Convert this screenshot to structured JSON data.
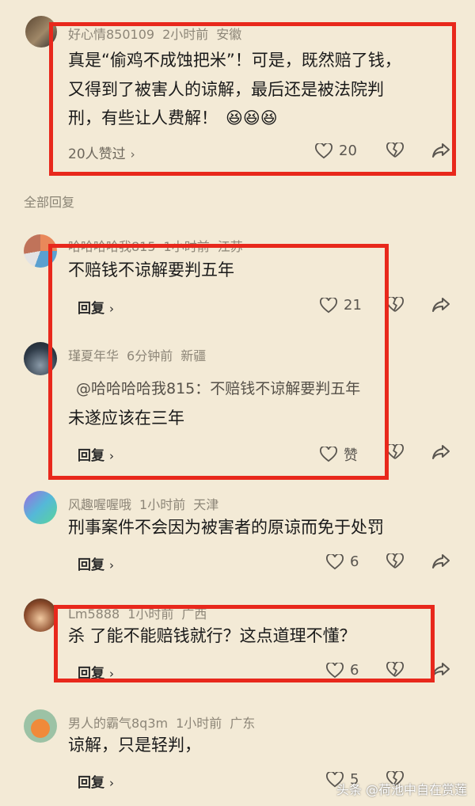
{
  "section_label": "全部回复",
  "watermark": "头条 @荷池中自在赏莲",
  "top_comment": {
    "user": "好心情850109",
    "time": "2小时前",
    "location": "安徽",
    "lines": [
      "真是“偷鸡不成蚀把米”！可是，既然赔了钱，",
      "又得到了被害人的谅解，最后还是被法院判",
      "刑，有些让人费解！"
    ],
    "emoji": "😆😆😆",
    "likers_label": "20人赞过",
    "likes": "20"
  },
  "replies": [
    {
      "user": "哈哈哈哈我815",
      "time": "1小时前",
      "location": "江苏",
      "text": "不赔钱不谅解要判五年",
      "reply_label": "回复",
      "likes": "21"
    },
    {
      "user": "瑾夏年华",
      "time": "6分钟前",
      "location": "新疆",
      "quote": "@哈哈哈哈我815：不赔钱不谅解要判五年",
      "text": "未遂应该在三年",
      "reply_label": "回复",
      "likes": "赞"
    },
    {
      "user": "风趣喔喔哦",
      "time": "1小时前",
      "location": "天津",
      "text": "刑事案件不会因为被害者的原谅而免于处罚",
      "reply_label": "回复",
      "likes": "6"
    },
    {
      "user": "Lm5888",
      "time": "1小时前",
      "location": "广西",
      "text": "杀    了能不能赔钱就行？这点道理不懂？",
      "reply_label": "回复",
      "likes": "6"
    },
    {
      "user": "男人的霸气8q3m",
      "time": "1小时前",
      "location": "广东",
      "text": "谅解，只是轻判，",
      "reply_label": "回复",
      "likes": "5"
    }
  ],
  "colors": {
    "background": "#f3ead6",
    "highlight": "#e8281c",
    "meta": "#8d8678"
  }
}
